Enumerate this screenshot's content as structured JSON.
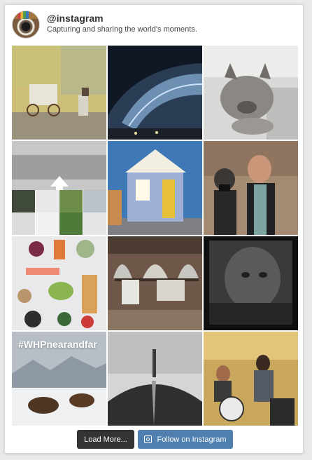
{
  "profile": {
    "handle": "@instagram",
    "tagline": "Capturing and sharing the world's moments."
  },
  "photos": [
    {
      "subject": "street-cart-photo"
    },
    {
      "subject": "night-building-photo"
    },
    {
      "subject": "french-bulldog-photo"
    },
    {
      "subject": "collage-arrow-photo"
    },
    {
      "subject": "blue-house-photo"
    },
    {
      "subject": "man-camera-photo"
    },
    {
      "subject": "food-spread-photo"
    },
    {
      "subject": "laundry-courtyard-photo"
    },
    {
      "subject": "dark-face-photo"
    },
    {
      "subject": "bison-snow-photo",
      "hashtag": "#WHPnearandfar"
    },
    {
      "subject": "mountain-path-photo"
    },
    {
      "subject": "band-drums-photo"
    }
  ],
  "footer": {
    "load_more_label": "Load More...",
    "follow_label": "Follow on Instagram"
  },
  "colors": {
    "load_button": "#333333",
    "follow_button": "#4f7fae"
  }
}
